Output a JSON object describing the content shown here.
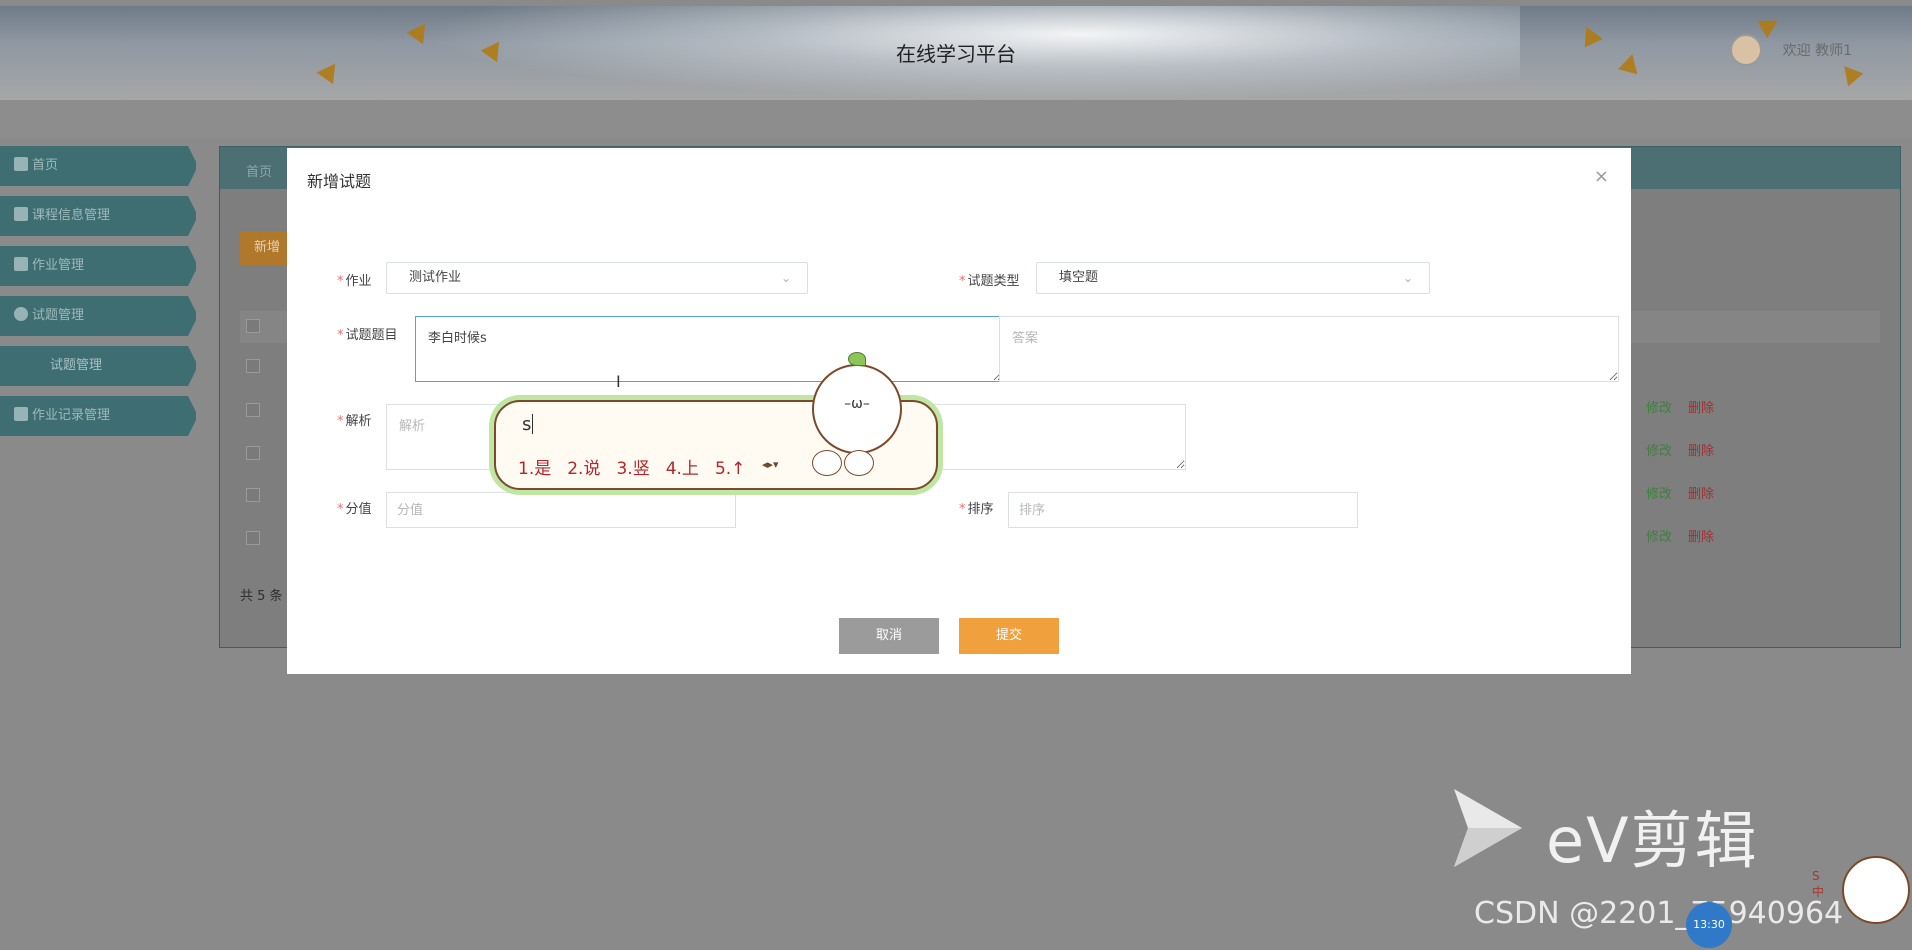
{
  "header": {
    "title": "在线学习平台",
    "welcome": "欢迎 教师1"
  },
  "sidebar": {
    "items": [
      {
        "label": "首页",
        "icon": "home-icon"
      },
      {
        "label": "课程信息管理",
        "icon": "grid-icon"
      },
      {
        "label": "作业管理",
        "icon": "book-icon"
      },
      {
        "label": "试题管理",
        "icon": "check-circle-icon"
      },
      {
        "label": "试题管理",
        "icon": ""
      },
      {
        "label": "作业记录管理",
        "icon": "list-icon"
      }
    ]
  },
  "content": {
    "tab_home": "首页",
    "new_button": "新增",
    "edit_label": "修改",
    "delete_label": "删除",
    "total_text": "共 5 条"
  },
  "modal": {
    "title": "新增试题",
    "close": "×",
    "fields": {
      "homework_label": "作业",
      "homework_value": "测试作业",
      "type_label": "试题类型",
      "type_value": "填空题",
      "question_label": "试题题目",
      "question_value": "李白时候s",
      "answer_placeholder": "答案",
      "analysis_label": "解析",
      "analysis_placeholder": "解析",
      "score_label": "分值",
      "score_placeholder": "分值",
      "order_label": "排序",
      "order_placeholder": "排序"
    },
    "cancel": "取消",
    "submit": "提交"
  },
  "ime": {
    "typed": "s",
    "candidates": [
      "1.是",
      "2.说",
      "3.竖",
      "4.上",
      "5.↑"
    ],
    "face": "–ω–"
  },
  "overlays": {
    "ev_text": "eV剪辑",
    "csdn": "CSDN @2201_75940964",
    "clock": "13:30",
    "vertical": "S中"
  }
}
